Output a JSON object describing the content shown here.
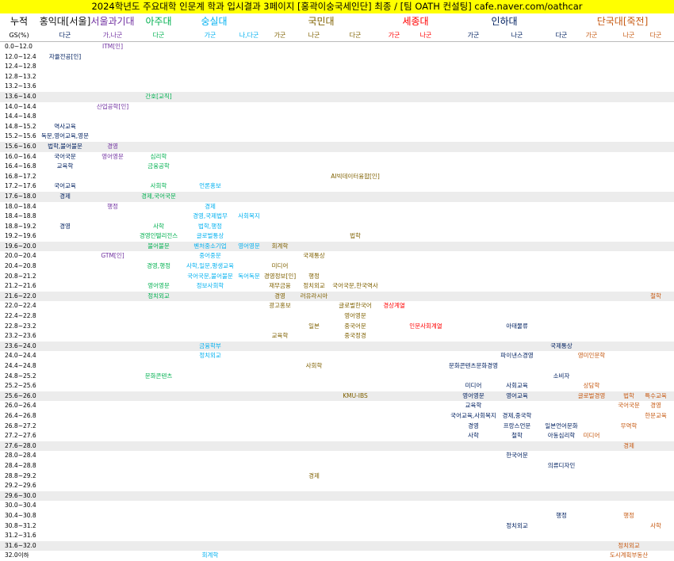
{
  "title": "2024학년도 주요대학 인문계 학과 입시결과 3페이지 [홍곽이숭국세인단] 최종 / [팀 OATH 컨설팅] cafe.naver.com/oathcar",
  "headers": [
    {
      "label": "누적",
      "color": "#000000"
    },
    {
      "label": "홍익대[서울]",
      "color": "#111111"
    },
    {
      "label": "서울과기대",
      "color": "#7030a0"
    },
    {
      "label": "아주대",
      "color": "#00b050"
    },
    {
      "label": "숭실대",
      "color": "#00b0f0"
    },
    {
      "label": "국민대",
      "color": "#7f6000"
    },
    {
      "label": "세종대",
      "color": "#ff0000"
    },
    {
      "label": "인하대",
      "color": "#002060"
    },
    {
      "label": "단국대[죽전]",
      "color": "#c65911"
    }
  ],
  "subheaders": [
    {
      "label": "GS(%)",
      "color": "#000000"
    },
    {
      "label": "다군",
      "color": "#002060"
    },
    {
      "label": "가,나군",
      "color": "#7030a0"
    },
    {
      "label": "다군",
      "color": "#00b050"
    },
    {
      "label": "가군",
      "color": "#00b0f0"
    },
    {
      "label": "나,다군",
      "color": "#00b0f0"
    },
    {
      "label": "가군",
      "color": "#7f6000"
    },
    {
      "label": "나군",
      "color": "#7f6000"
    },
    {
      "label": "다군",
      "color": "#7f6000"
    },
    {
      "label": "가군",
      "color": "#ff0000"
    },
    {
      "label": "나군",
      "color": "#ff0000"
    },
    {
      "label": "가군",
      "color": "#002060"
    },
    {
      "label": "나군",
      "color": "#002060"
    },
    {
      "label": "다군",
      "color": "#002060"
    },
    {
      "label": "가군",
      "color": "#c65911"
    },
    {
      "label": "나군",
      "color": "#c65911"
    },
    {
      "label": "다군",
      "color": "#c65911"
    }
  ],
  "colors": {
    "c0": "#002060",
    "c1": "#7030a0",
    "c2": "#00b050",
    "c3": "#00b0f0",
    "c4": "#00b0f0",
    "c5": "#7f6000",
    "c6": "#7f6000",
    "c7": "#7f6000",
    "c8": "#ff0000",
    "c9": "#ff0000",
    "c10": "#002060",
    "c11": "#002060",
    "c12": "#002060",
    "c13": "#c65911",
    "c14": "#c65911",
    "c15": "#c65911"
  },
  "rows": [
    {
      "gs": "0.0~12.0",
      "shade": false,
      "entries": [
        [
          1,
          "ITM[인]"
        ]
      ]
    },
    {
      "gs": "12.0~12.4",
      "shade": false,
      "entries": [
        [
          0,
          "자율전공[인]"
        ]
      ]
    },
    {
      "gs": "12.4~12.8",
      "shade": false,
      "entries": []
    },
    {
      "gs": "12.8~13.2",
      "shade": false,
      "entries": []
    },
    {
      "gs": "13.2~13.6",
      "shade": false,
      "entries": []
    },
    {
      "gs": "13.6~14.0",
      "shade": true,
      "entries": [
        [
          2,
          "간호[교직]"
        ]
      ]
    },
    {
      "gs": "14.0~14.4",
      "shade": false,
      "entries": [
        [
          1,
          "산업공학[인]"
        ]
      ]
    },
    {
      "gs": "14.4~14.8",
      "shade": false,
      "entries": []
    },
    {
      "gs": "14.8~15.2",
      "shade": false,
      "entries": [
        [
          0,
          "역사교육"
        ]
      ]
    },
    {
      "gs": "15.2~15.6",
      "shade": false,
      "entries": [
        [
          0,
          "독문,영어교육,영문"
        ]
      ]
    },
    {
      "gs": "15.6~16.0",
      "shade": true,
      "entries": [
        [
          0,
          "법학,불어불문"
        ],
        [
          1,
          "경영"
        ]
      ]
    },
    {
      "gs": "16.0~16.4",
      "shade": false,
      "entries": [
        [
          0,
          "국어국문"
        ],
        [
          1,
          "영어영문"
        ],
        [
          2,
          "심리학"
        ]
      ]
    },
    {
      "gs": "16.4~16.8",
      "shade": false,
      "entries": [
        [
          0,
          "교육학"
        ],
        [
          2,
          "금융공학"
        ]
      ]
    },
    {
      "gs": "16.8~17.2",
      "shade": false,
      "entries": [
        [
          7,
          "AI빅데이터융합[인]"
        ]
      ]
    },
    {
      "gs": "17.2~17.6",
      "shade": false,
      "entries": [
        [
          0,
          "국어교육"
        ],
        [
          2,
          "사회학"
        ],
        [
          3,
          "언론홍보"
        ]
      ]
    },
    {
      "gs": "17.6~18.0",
      "shade": true,
      "entries": [
        [
          0,
          "경제"
        ],
        [
          2,
          "경제,국어국문"
        ]
      ]
    },
    {
      "gs": "18.0~18.4",
      "shade": false,
      "entries": [
        [
          1,
          "행정"
        ],
        [
          3,
          "경제"
        ]
      ]
    },
    {
      "gs": "18.4~18.8",
      "shade": false,
      "entries": [
        [
          3,
          "경영,국제법무"
        ],
        [
          4,
          "사회복지"
        ]
      ]
    },
    {
      "gs": "18.8~19.2",
      "shade": false,
      "entries": [
        [
          0,
          "경영"
        ],
        [
          2,
          "사학"
        ],
        [
          3,
          "법학,행정"
        ]
      ]
    },
    {
      "gs": "19.2~19.6",
      "shade": false,
      "entries": [
        [
          2,
          "경영인텔리전스"
        ],
        [
          3,
          "글로벌통상"
        ],
        [
          7,
          "법학"
        ]
      ]
    },
    {
      "gs": "19.6~20.0",
      "shade": true,
      "entries": [
        [
          2,
          "불어불문"
        ],
        [
          3,
          "벤처중소기업"
        ],
        [
          4,
          "영어영문"
        ],
        [
          5,
          "회계학"
        ]
      ]
    },
    {
      "gs": "20.0~20.4",
      "shade": false,
      "entries": [
        [
          1,
          "GTM[인]"
        ],
        [
          3,
          "중어중문"
        ],
        [
          6,
          "국제통상"
        ]
      ]
    },
    {
      "gs": "20.4~20.8",
      "shade": false,
      "entries": [
        [
          2,
          "경영,행정"
        ],
        [
          3,
          "사학,일문,평생교육"
        ],
        [
          5,
          "미디어"
        ]
      ]
    },
    {
      "gs": "20.8~21.2",
      "shade": false,
      "entries": [
        [
          3,
          "국어국문,불어불문"
        ],
        [
          4,
          "독어독문"
        ],
        [
          5,
          "경영정보[인]"
        ],
        [
          6,
          "행정"
        ]
      ]
    },
    {
      "gs": "21.2~21.6",
      "shade": false,
      "entries": [
        [
          2,
          "영어영문"
        ],
        [
          3,
          "정보사회학"
        ],
        [
          5,
          "재무금융"
        ],
        [
          6,
          "정치외교"
        ],
        [
          7,
          "국어국문,한국역사"
        ]
      ]
    },
    {
      "gs": "21.6~22.0",
      "shade": true,
      "entries": [
        [
          2,
          "정치외교"
        ],
        [
          5,
          "경영"
        ],
        [
          6,
          "러유라시아"
        ],
        [
          15,
          "철학"
        ]
      ]
    },
    {
      "gs": "22.0~22.4",
      "shade": false,
      "entries": [
        [
          5,
          "광고홍보"
        ],
        [
          7,
          "글로벌한국어"
        ],
        [
          8,
          "경상계열"
        ]
      ]
    },
    {
      "gs": "22.4~22.8",
      "shade": false,
      "entries": [
        [
          7,
          "영어영문"
        ]
      ]
    },
    {
      "gs": "22.8~23.2",
      "shade": false,
      "entries": [
        [
          6,
          "일본"
        ],
        [
          7,
          "중국어문"
        ],
        [
          9,
          "인문사회계열"
        ],
        [
          11,
          "아태물류"
        ]
      ]
    },
    {
      "gs": "23.2~23.6",
      "shade": false,
      "entries": [
        [
          5,
          "교육학"
        ],
        [
          7,
          "중국정경"
        ]
      ]
    },
    {
      "gs": "23.6~24.0",
      "shade": true,
      "entries": [
        [
          3,
          "금융학부"
        ],
        [
          12,
          "국제통상"
        ]
      ]
    },
    {
      "gs": "24.0~24.4",
      "shade": false,
      "entries": [
        [
          3,
          "정치외교"
        ],
        [
          11,
          "파이낸스경영"
        ],
        [
          13,
          "영미인문학"
        ]
      ]
    },
    {
      "gs": "24.4~24.8",
      "shade": false,
      "entries": [
        [
          6,
          "사회학"
        ],
        [
          10,
          "문화콘텐츠문화경영"
        ]
      ]
    },
    {
      "gs": "24.8~25.2",
      "shade": false,
      "entries": [
        [
          2,
          "문화콘텐츠"
        ],
        [
          12,
          "소비자"
        ]
      ]
    },
    {
      "gs": "25.2~25.6",
      "shade": false,
      "entries": [
        [
          10,
          "미디어"
        ],
        [
          11,
          "사회교육"
        ],
        [
          13,
          "상담학"
        ]
      ]
    },
    {
      "gs": "25.6~26.0",
      "shade": true,
      "entries": [
        [
          7,
          "KMU-IBS"
        ],
        [
          10,
          "영어영문"
        ],
        [
          11,
          "영어교육"
        ],
        [
          13,
          "글로벌경영"
        ],
        [
          14,
          "법학"
        ],
        [
          15,
          "특수교육"
        ]
      ]
    },
    {
      "gs": "26.0~26.4",
      "shade": false,
      "entries": [
        [
          10,
          "교육학"
        ],
        [
          14,
          "국어국문"
        ],
        [
          15,
          "경영"
        ]
      ]
    },
    {
      "gs": "26.4~26.8",
      "shade": false,
      "entries": [
        [
          10,
          "국어교육,사회복지"
        ],
        [
          11,
          "경제,중국학"
        ],
        [
          15,
          "한문교육"
        ]
      ]
    },
    {
      "gs": "26.8~27.2",
      "shade": false,
      "entries": [
        [
          10,
          "경영"
        ],
        [
          11,
          "프랑스언문"
        ],
        [
          12,
          "일본언어문화"
        ],
        [
          14,
          "무역학"
        ]
      ]
    },
    {
      "gs": "27.2~27.6",
      "shade": false,
      "entries": [
        [
          10,
          "사학"
        ],
        [
          11,
          "철학"
        ],
        [
          12,
          "아동심리학"
        ],
        [
          13,
          "미디어"
        ]
      ]
    },
    {
      "gs": "27.6~28.0",
      "shade": true,
      "entries": [
        [
          14,
          "경제"
        ]
      ]
    },
    {
      "gs": "28.0~28.4",
      "shade": false,
      "entries": [
        [
          11,
          "한국어문"
        ]
      ]
    },
    {
      "gs": "28.4~28.8",
      "shade": false,
      "entries": [
        [
          12,
          "의류디자인"
        ]
      ]
    },
    {
      "gs": "28.8~29.2",
      "shade": false,
      "entries": [
        [
          6,
          "경제"
        ]
      ]
    },
    {
      "gs": "29.2~29.6",
      "shade": false,
      "entries": []
    },
    {
      "gs": "29.6~30.0",
      "shade": true,
      "entries": []
    },
    {
      "gs": "30.0~30.4",
      "shade": false,
      "entries": []
    },
    {
      "gs": "30.4~30.8",
      "shade": false,
      "entries": [
        [
          12,
          "행정"
        ],
        [
          14,
          "행정"
        ]
      ]
    },
    {
      "gs": "30.8~31.2",
      "shade": false,
      "entries": [
        [
          11,
          "정치외교"
        ],
        [
          15,
          "사학"
        ]
      ]
    },
    {
      "gs": "31.2~31.6",
      "shade": false,
      "entries": []
    },
    {
      "gs": "31.6~32.0",
      "shade": true,
      "entries": [
        [
          14,
          "정치외교"
        ]
      ]
    },
    {
      "gs": "32.0이하",
      "shade": false,
      "entries": [
        [
          3,
          "회계학"
        ],
        [
          14,
          "도시계획부동산"
        ]
      ]
    }
  ]
}
